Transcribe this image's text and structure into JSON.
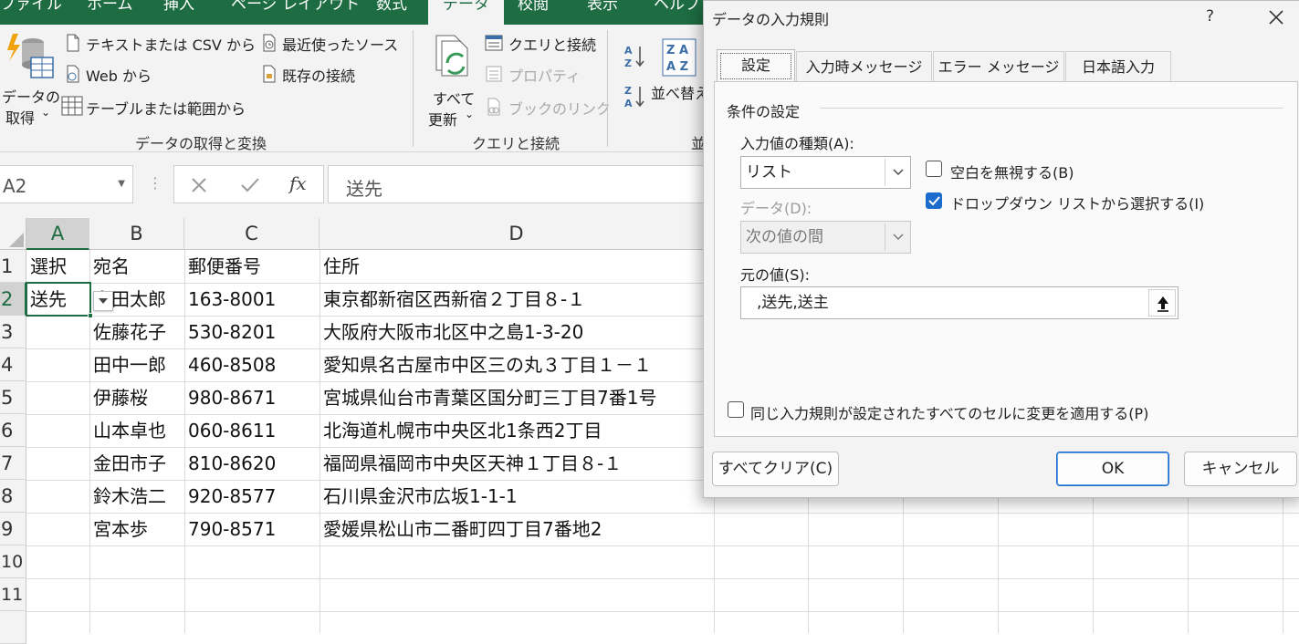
{
  "ribbon_tabs": [
    "ファイル",
    "ホーム",
    "挿入",
    "ページ レイアウト",
    "数式",
    "データ",
    "校閲",
    "表示",
    "ヘルプ"
  ],
  "ribbon": {
    "get_data_line1": "データの",
    "get_data_line2": "取得",
    "from_text_csv": "テキストまたは CSV から",
    "from_web": "Web から",
    "from_table": "テーブルまたは範囲から",
    "recent_sources": "最近使ったソース",
    "existing_connections": "既存の接続",
    "group_get_transform": "データの取得と変換",
    "refresh_line1": "すべて",
    "refresh_line2": "更新",
    "queries_connections": "クエリと接続",
    "properties": "プロパティ",
    "workbook_links": "ブックのリンク",
    "group_queries": "クエリと接続",
    "sort": "並べ替え",
    "group_sort_partial": "並"
  },
  "formula_bar": {
    "name_box": "A2",
    "formula": "送先"
  },
  "grid": {
    "columns": [
      "A",
      "B",
      "C",
      "D"
    ],
    "rows": [
      [
        "選択",
        "宛名",
        "郵便番号",
        "住所"
      ],
      [
        "送先",
        "山田太郎",
        "163-8001",
        "東京都新宿区西新宿２丁目８-１"
      ],
      [
        "",
        "佐藤花子",
        "530-8201",
        "大阪府大阪市北区中之島1-3-20"
      ],
      [
        "",
        "田中一郎",
        "460-8508",
        "愛知県名古屋市中区三の丸３丁目１－１"
      ],
      [
        "",
        "伊藤桜",
        "980-8671",
        "宮城県仙台市青葉区国分町三丁目7番1号"
      ],
      [
        "",
        "山本卓也",
        "060-8611",
        "北海道札幌市中央区北1条西2丁目"
      ],
      [
        "",
        "金田市子",
        "810-8620",
        "福岡県福岡市中央区天神１丁目８-１"
      ],
      [
        "",
        "鈴木浩二",
        "920-8577",
        "石川県金沢市広坂1-1-1"
      ],
      [
        "",
        "宮本歩",
        "790-8571",
        "愛媛県松山市二番町四丁目7番地2"
      ],
      [
        "",
        "",
        "",
        ""
      ],
      [
        "",
        "",
        "",
        ""
      ]
    ],
    "row_numbers": [
      "1",
      "2",
      "3",
      "4",
      "5",
      "6",
      "7",
      "8",
      "9",
      "10",
      "11"
    ]
  },
  "dialog": {
    "title": "データの入力規則",
    "help": "?",
    "tabs": [
      "設定",
      "入力時メッセージ",
      "エラー メッセージ",
      "日本語入力"
    ],
    "section": "条件の設定",
    "allow_label": "入力値の種類(A):",
    "allow_value": "リスト",
    "data_label": "データ(D):",
    "data_value": "次の値の間",
    "ignore_blank": "空白を無視する(B)",
    "ignore_blank_checked": false,
    "in_cell_dropdown": "ドロップダウン リストから選択する(I)",
    "in_cell_dropdown_checked": true,
    "source_label": "元の値(S):",
    "source_value": ",送先,送主",
    "apply_all": "同じ入力規則が設定されたすべてのセルに変更を適用する(P)",
    "apply_all_checked": false,
    "clear_all": "すべてクリア(C)",
    "ok": "OK",
    "cancel": "キャンセル"
  },
  "colors": {
    "excel_green": "#1e6c41",
    "check_blue": "#1b6ccd"
  }
}
